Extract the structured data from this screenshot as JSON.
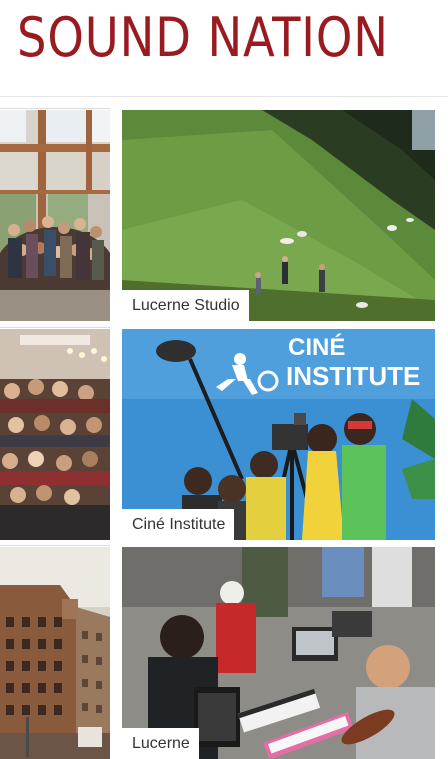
{
  "site": {
    "logo_text": "SOUND NATION"
  },
  "tiles": [
    {
      "caption": "Lucerne Studio"
    },
    {
      "caption": "Ciné Institute"
    },
    {
      "caption": "Lucerne"
    }
  ],
  "cine_sign": {
    "line1": "CINÉ",
    "line2": "INSTITUTE"
  },
  "colors": {
    "brand_red": "#9a1b1f",
    "caption_text": "#333333",
    "caption_bg": "#ffffff",
    "cine_sky": "#3b8fd3"
  }
}
